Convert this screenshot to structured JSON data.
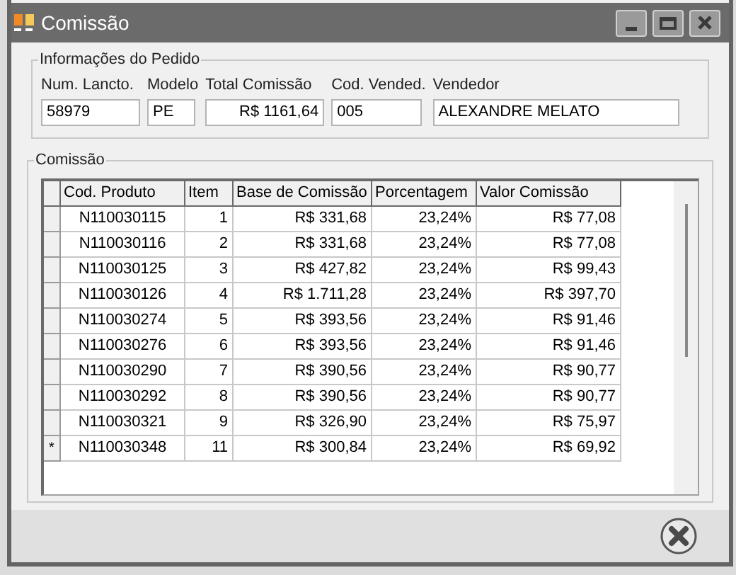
{
  "window": {
    "title": "Comissão"
  },
  "order_info": {
    "title": "Informações do Pedido",
    "fields": [
      {
        "label": "Num. Lancto.",
        "value": "58979"
      },
      {
        "label": "Modelo",
        "value": "PE"
      },
      {
        "label": "Total Comissão",
        "value": "R$ 1161,64"
      },
      {
        "label": "Cod. Vended.",
        "value": "005"
      },
      {
        "label": "Vendedor",
        "value": "ALEXANDRE MELATO"
      }
    ]
  },
  "commission": {
    "title": "Comissão",
    "table": {
      "columns": [
        "Cod. Produto",
        "Item",
        "Base de Comissão",
        "Porcentagem",
        "Valor Comissão"
      ],
      "rows": [
        {
          "cells": [
            "N110030115",
            "1",
            "R$ 331,68",
            "23,24%",
            "R$ 77,08"
          ]
        },
        {
          "cells": [
            "N110030116",
            "2",
            "R$ 331,68",
            "23,24%",
            "R$ 77,08"
          ]
        },
        {
          "cells": [
            "N110030125",
            "3",
            "R$ 427,82",
            "23,24%",
            "R$ 99,43"
          ]
        },
        {
          "cells": [
            "N110030126",
            "4",
            "R$ 1.711,28",
            "23,24%",
            "R$ 397,70"
          ]
        },
        {
          "cells": [
            "N110030274",
            "5",
            "R$ 393,56",
            "23,24%",
            "R$ 91,46"
          ]
        },
        {
          "cells": [
            "N110030276",
            "6",
            "R$ 393,56",
            "23,24%",
            "R$ 91,46"
          ]
        },
        {
          "cells": [
            "N110030290",
            "7",
            "R$ 390,56",
            "23,24%",
            "R$ 90,77"
          ]
        },
        {
          "cells": [
            "N110030292",
            "8",
            "R$ 390,56",
            "23,24%",
            "R$ 90,77"
          ]
        },
        {
          "cells": [
            "N110030321",
            "9",
            "R$ 326,90",
            "23,24%",
            "R$ 75,97"
          ]
        },
        {
          "cells": [
            "N110030348",
            "11",
            "R$ 300,84",
            "23,24%",
            "R$ 69,92"
          ],
          "marker": "*"
        }
      ]
    }
  }
}
